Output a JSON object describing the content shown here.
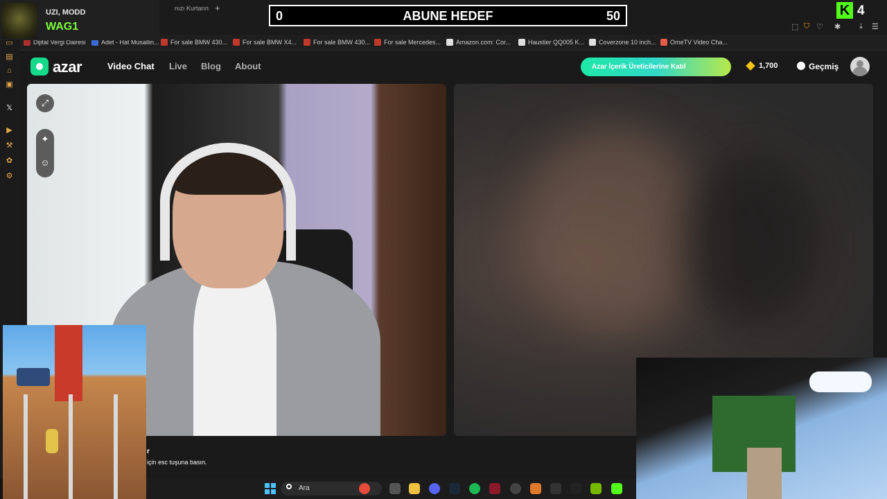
{
  "stream_overlay": {
    "streamer_title": "UZI, MODD",
    "streamer_name": "WAG1",
    "goal": {
      "current": "0",
      "label": "ABUNE HEDEF",
      "target": "50",
      "progress": 0.0
    },
    "kick_count": "4",
    "kick_logo": "K"
  },
  "browser": {
    "tab_partial": "nızı Kurtarın",
    "new_tab": "+",
    "bookmarks": [
      {
        "label": "Dijital Vergi Dairesi",
        "color": "#b03030"
      },
      {
        "label": "Adet - Hat Musallin...",
        "color": "#3a6bd6"
      },
      {
        "label": "For sale BMW 430...",
        "color": "#c0392b"
      },
      {
        "label": "For sale BMW X4...",
        "color": "#c0392b"
      },
      {
        "label": "For sale BMW 430...",
        "color": "#c0392b"
      },
      {
        "label": "For sale Mercedes...",
        "color": "#c0392b"
      },
      {
        "label": "Amazon.com: Cor...",
        "color": "#e0e0e0"
      },
      {
        "label": "Haustier QQ005 K...",
        "color": "#e0e0e0"
      },
      {
        "label": "Coverzone 10 inch...",
        "color": "#e0e0e0"
      },
      {
        "label": "OmeTV Video Cha...",
        "color": "#e85a4a"
      }
    ]
  },
  "azar": {
    "logo": "azar",
    "nav": {
      "video_chat": "Video Chat",
      "live": "Live",
      "blog": "Blog",
      "about": "About"
    },
    "creator_button": "Azar İçerik Üreticilerine Katıl",
    "gems": "1,700",
    "history": "Geçmiş"
  },
  "bottom": {
    "esc_title": "r",
    "esc_hint": "için esc tuşuna basın."
  },
  "taskbar": {
    "search_label": "Ara"
  },
  "colors": {
    "azar_green": "#16d98a",
    "kick_green": "#53fc18",
    "streamer_name": "#7dff3a",
    "gem": "#f5c518"
  }
}
